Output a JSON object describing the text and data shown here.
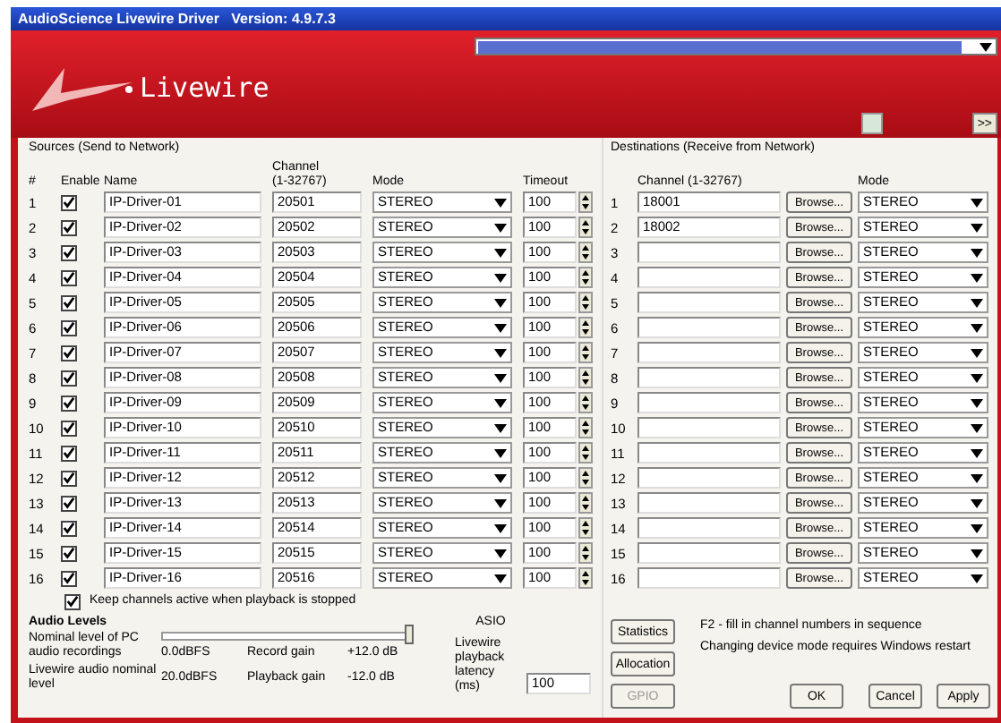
{
  "window": {
    "title": "AudioScience Livewire Driver   Version: 4.9.7.3"
  },
  "header": {
    "brand": "Livewire",
    "next_button": ">>"
  },
  "sources": {
    "title": "Sources (Send to Network)",
    "columns": [
      "#",
      "Enable",
      "Name",
      "Channel\n(1-32767)",
      "Mode",
      "Timeout"
    ],
    "rows": [
      {
        "index": "1",
        "enabled": true,
        "name": "IP-Driver-01",
        "channel": "20501",
        "mode": "STEREO",
        "timeout": "100"
      },
      {
        "index": "2",
        "enabled": true,
        "name": "IP-Driver-02",
        "channel": "20502",
        "mode": "STEREO",
        "timeout": "100"
      },
      {
        "index": "3",
        "enabled": true,
        "name": "IP-Driver-03",
        "channel": "20503",
        "mode": "STEREO",
        "timeout": "100"
      },
      {
        "index": "4",
        "enabled": true,
        "name": "IP-Driver-04",
        "channel": "20504",
        "mode": "STEREO",
        "timeout": "100"
      },
      {
        "index": "5",
        "enabled": true,
        "name": "IP-Driver-05",
        "channel": "20505",
        "mode": "STEREO",
        "timeout": "100"
      },
      {
        "index": "6",
        "enabled": true,
        "name": "IP-Driver-06",
        "channel": "20506",
        "mode": "STEREO",
        "timeout": "100"
      },
      {
        "index": "7",
        "enabled": true,
        "name": "IP-Driver-07",
        "channel": "20507",
        "mode": "STEREO",
        "timeout": "100"
      },
      {
        "index": "8",
        "enabled": true,
        "name": "IP-Driver-08",
        "channel": "20508",
        "mode": "STEREO",
        "timeout": "100"
      },
      {
        "index": "9",
        "enabled": true,
        "name": "IP-Driver-09",
        "channel": "20509",
        "mode": "STEREO",
        "timeout": "100"
      },
      {
        "index": "10",
        "enabled": true,
        "name": "IP-Driver-10",
        "channel": "20510",
        "mode": "STEREO",
        "timeout": "100"
      },
      {
        "index": "11",
        "enabled": true,
        "name": "IP-Driver-11",
        "channel": "20511",
        "mode": "STEREO",
        "timeout": "100"
      },
      {
        "index": "12",
        "enabled": true,
        "name": "IP-Driver-12",
        "channel": "20512",
        "mode": "STEREO",
        "timeout": "100"
      },
      {
        "index": "13",
        "enabled": true,
        "name": "IP-Driver-13",
        "channel": "20513",
        "mode": "STEREO",
        "timeout": "100"
      },
      {
        "index": "14",
        "enabled": true,
        "name": "IP-Driver-14",
        "channel": "20514",
        "mode": "STEREO",
        "timeout": "100"
      },
      {
        "index": "15",
        "enabled": true,
        "name": "IP-Driver-15",
        "channel": "20515",
        "mode": "STEREO",
        "timeout": "100"
      },
      {
        "index": "16",
        "enabled": true,
        "name": "IP-Driver-16",
        "channel": "20516",
        "mode": "STEREO",
        "timeout": "100"
      }
    ]
  },
  "keep_active": {
    "label": "Keep channels active when playback is stopped",
    "checked": true
  },
  "audio_levels": {
    "title": "Audio Levels",
    "pc_label": "Nominal level of PC audio recordings",
    "pc_slider": {
      "level": 1.0
    },
    "pc_value": "0.0dBFS",
    "lw_label": "Livewire audio nominal level",
    "lw_value": "20.0dBFS",
    "record_label": "Record gain",
    "record_value": "+12.0 dB",
    "playback_label": "Playback gain",
    "playback_value": "-12.0 dB"
  },
  "asio": {
    "title": "ASIO",
    "label": "Livewire playback latency (ms)",
    "value": "100"
  },
  "destinations": {
    "title": "Destinations (Receive from Network)",
    "columns": [
      "Channel (1-32767)",
      "Mode"
    ],
    "rows": [
      {
        "index": "1",
        "channel": "18001",
        "browse": "Browse...",
        "mode": "STEREO"
      },
      {
        "index": "2",
        "channel": "18002",
        "browse": "Browse...",
        "mode": "STEREO"
      },
      {
        "index": "3",
        "channel": "",
        "browse": "Browse...",
        "mode": "STEREO"
      },
      {
        "index": "4",
        "channel": "",
        "browse": "Browse...",
        "mode": "STEREO"
      },
      {
        "index": "5",
        "channel": "",
        "browse": "Browse...",
        "mode": "STEREO"
      },
      {
        "index": "6",
        "channel": "",
        "browse": "Browse...",
        "mode": "STEREO"
      },
      {
        "index": "7",
        "channel": "",
        "browse": "Browse...",
        "mode": "STEREO"
      },
      {
        "index": "8",
        "channel": "",
        "browse": "Browse...",
        "mode": "STEREO"
      },
      {
        "index": "9",
        "channel": "",
        "browse": "Browse...",
        "mode": "STEREO"
      },
      {
        "index": "10",
        "channel": "",
        "browse": "Browse...",
        "mode": "STEREO"
      },
      {
        "index": "11",
        "channel": "",
        "browse": "Browse...",
        "mode": "STEREO"
      },
      {
        "index": "12",
        "channel": "",
        "browse": "Browse...",
        "mode": "STEREO"
      },
      {
        "index": "13",
        "channel": "",
        "browse": "Browse...",
        "mode": "STEREO"
      },
      {
        "index": "14",
        "channel": "",
        "browse": "Browse...",
        "mode": "STEREO"
      },
      {
        "index": "15",
        "channel": "",
        "browse": "Browse...",
        "mode": "STEREO"
      },
      {
        "index": "16",
        "channel": "",
        "browse": "Browse...",
        "mode": "STEREO"
      }
    ]
  },
  "side_buttons": [
    {
      "label": "Statistics",
      "disabled": false
    },
    {
      "label": "Allocation",
      "disabled": false
    },
    {
      "label": "GPIO",
      "disabled": true
    }
  ],
  "notes": [
    "F2 - fill in channel numbers in sequence",
    "Changing device mode requires Windows restart"
  ],
  "dialog_buttons": [
    "OK",
    "Cancel",
    "Apply"
  ]
}
